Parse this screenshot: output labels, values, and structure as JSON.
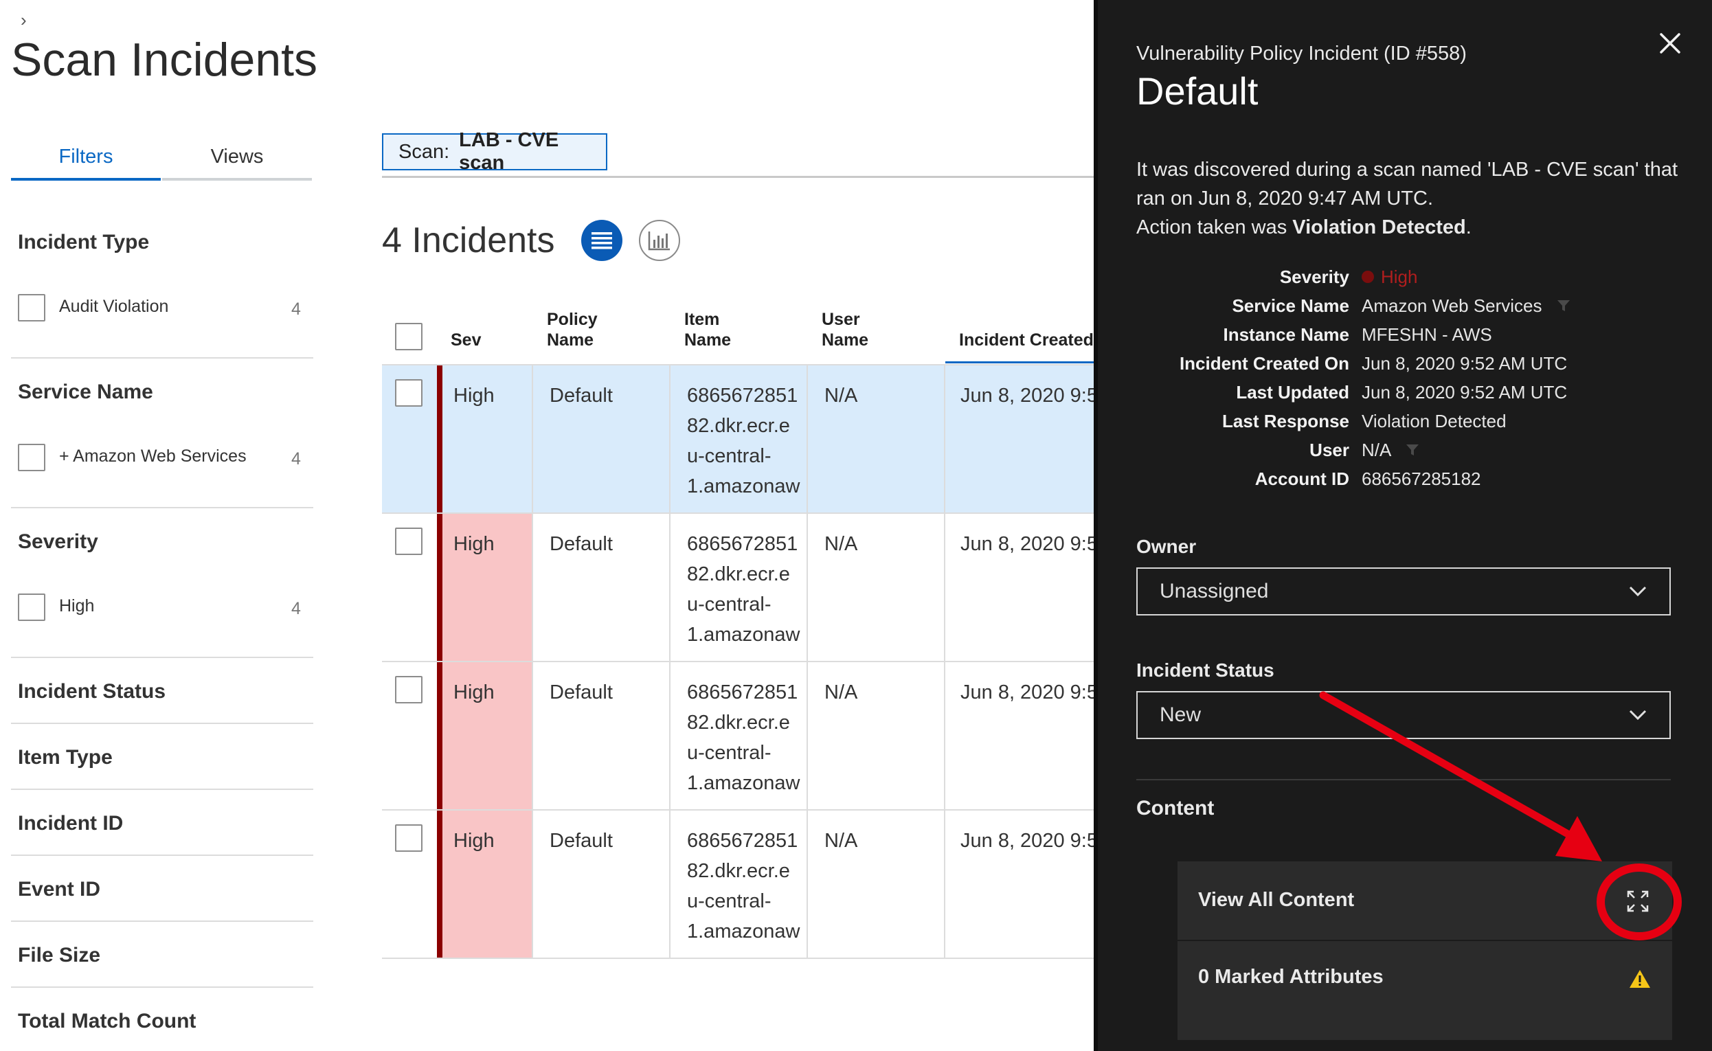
{
  "breadcrumb": "›",
  "page_title": "Scan Incidents",
  "tabs": [
    {
      "label": "Filters"
    },
    {
      "label": "Views"
    }
  ],
  "filters": {
    "incident_type": {
      "heading": "Incident Type",
      "option": "Audit Violation",
      "count": "4"
    },
    "service_name": {
      "heading": "Service Name",
      "option": "+ Amazon Web Services",
      "count": "4"
    },
    "severity": {
      "heading": "Severity",
      "option": "High",
      "count": "4"
    },
    "collapsed": [
      "Incident Status",
      "Item Type",
      "Incident ID",
      "Event ID",
      "File Size",
      "Total Match Count"
    ]
  },
  "scan_chip": {
    "prefix": "Scan:",
    "value": "LAB - CVE scan"
  },
  "incidents_count": "4 Incidents",
  "table": {
    "headers": {
      "sev": "Sev",
      "policy_1": "Policy",
      "policy_2": "Name",
      "item_1": "Item",
      "item_2": "Name",
      "user_1": "User",
      "user_2": "Name",
      "created": "Incident Created"
    },
    "rows": [
      {
        "sev": "High",
        "policy": "Default",
        "item_lines": [
          "6865672851",
          "82.dkr.ecr.e",
          "u-central-",
          "1.amazonaw"
        ],
        "user": "N/A",
        "created": "Jun 8, 2020 9:5"
      },
      {
        "sev": "High",
        "policy": "Default",
        "item_lines": [
          "6865672851",
          "82.dkr.ecr.e",
          "u-central-",
          "1.amazonaw"
        ],
        "user": "N/A",
        "created": "Jun 8, 2020 9:5"
      },
      {
        "sev": "High",
        "policy": "Default",
        "item_lines": [
          "6865672851",
          "82.dkr.ecr.e",
          "u-central-",
          "1.amazonaw"
        ],
        "user": "N/A",
        "created": "Jun 8, 2020 9:5"
      },
      {
        "sev": "High",
        "policy": "Default",
        "item_lines": [
          "6865672851",
          "82.dkr.ecr.e",
          "u-central-",
          "1.amazonaw"
        ],
        "user": "N/A",
        "created": "Jun 8, 2020 9:5"
      }
    ]
  },
  "panel": {
    "subtitle": "Vulnerability Policy Incident (ID #558)",
    "title": "Default",
    "desc_line1": "It was discovered during a scan named 'LAB - CVE scan' that",
    "desc_line2": "ran on Jun 8, 2020 9:47 AM UTC.",
    "desc_line3_prefix": "Action taken was ",
    "desc_line3_bold": "Violation Detected",
    "desc_line3_suffix": ".",
    "details": [
      {
        "k": "Severity",
        "v": "High"
      },
      {
        "k": "Service Name",
        "v": "Amazon Web Services"
      },
      {
        "k": "Instance Name",
        "v": "MFESHN - AWS"
      },
      {
        "k": "Incident Created On",
        "v": "Jun 8, 2020 9:52 AM UTC"
      },
      {
        "k": "Last Updated",
        "v": "Jun 8, 2020 9:52 AM UTC"
      },
      {
        "k": "Last Response",
        "v": "Violation Detected"
      },
      {
        "k": "User",
        "v": "N/A"
      },
      {
        "k": "Account ID",
        "v": "686567285182"
      }
    ],
    "owner_label": "Owner",
    "owner_value": "Unassigned",
    "status_label": "Incident Status",
    "status_value": "New",
    "content_label": "Content",
    "view_all": "View All Content",
    "marked": "0 Marked Attributes"
  },
  "colors": {
    "accent": "#0a68c4",
    "severity_red": "#8b0000",
    "high_text": "#c0221f",
    "row_selected": "#d9ebfb",
    "sev_pink": "#f9c5c6",
    "annotation": "#e60012"
  }
}
